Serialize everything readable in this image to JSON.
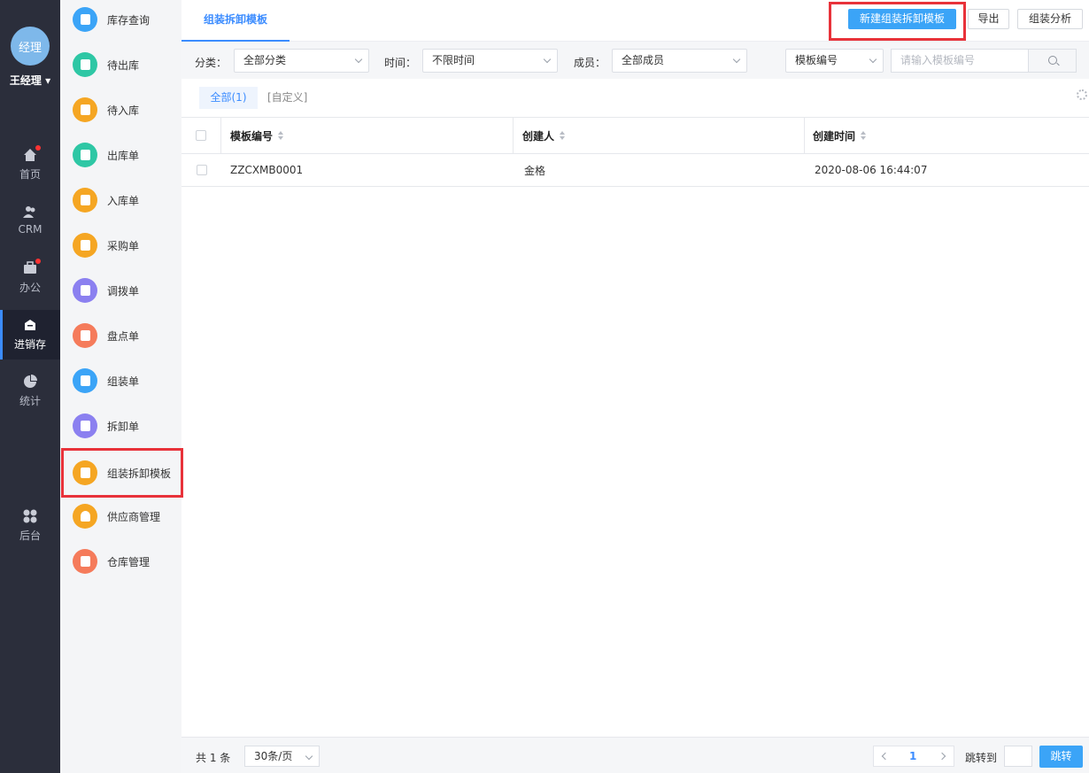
{
  "rail": {
    "avatar": "经理",
    "user_name": "王经理",
    "items": [
      {
        "label": "首页",
        "icon": "home-icon",
        "dot": true
      },
      {
        "label": "CRM",
        "icon": "users-icon",
        "dot": false
      },
      {
        "label": "办公",
        "icon": "briefcase-icon",
        "dot": true
      },
      {
        "label": "进销存",
        "icon": "inventory-icon",
        "dot": false,
        "active": true
      },
      {
        "label": "统计",
        "icon": "pie-chart-icon",
        "dot": false
      },
      {
        "label": "后台",
        "icon": "grid-icon",
        "dot": false
      }
    ]
  },
  "submenu": {
    "items": [
      {
        "label": "库存查询",
        "color": "#3ba4f7"
      },
      {
        "label": "待出库",
        "color": "#2ec7a5"
      },
      {
        "label": "待入库",
        "color": "#f5a623"
      },
      {
        "label": "出库单",
        "color": "#2ec7a5"
      },
      {
        "label": "入库单",
        "color": "#f5a623"
      },
      {
        "label": "采购单",
        "color": "#f5a623"
      },
      {
        "label": "调拨单",
        "color": "#8b80f0"
      },
      {
        "label": "盘点单",
        "color": "#f57b5b"
      },
      {
        "label": "组装单",
        "color": "#3ba4f7"
      },
      {
        "label": "拆卸单",
        "color": "#8b80f0"
      },
      {
        "label": "组装拆卸模板",
        "color": "#f5a623",
        "selected": true
      },
      {
        "label": "供应商管理",
        "color": "#f5a623"
      },
      {
        "label": "仓库管理",
        "color": "#f57b5b"
      }
    ]
  },
  "header": {
    "tab": "组装拆卸模板",
    "new_button": "新建组装拆卸模板",
    "export_button": "导出",
    "analysis_button": "组装分析"
  },
  "filters": {
    "category_label": "分类：",
    "category_value": "全部分类",
    "time_label": "时间：",
    "time_value": "不限时间",
    "member_label": "成员：",
    "member_value": "全部成员",
    "search_field": "模板编号",
    "search_placeholder": "请输入模板编号"
  },
  "views": {
    "all": "全部(1)",
    "custom": "[自定义]"
  },
  "table": {
    "columns": [
      "模板编号",
      "创建人",
      "创建时间"
    ],
    "rows": [
      [
        "ZZCXMB0001",
        "金格",
        "2020-08-06 16:44:07"
      ]
    ]
  },
  "footer": {
    "total": "共 1 条",
    "page_size": "30条/页",
    "current_page": "1",
    "jump_label": "跳转到",
    "jump_button": "跳转"
  },
  "colors": {
    "accent": "#3b8cff",
    "primary_button": "#3ba4f7",
    "highlight": "#e8323a",
    "rail_bg": "#2b2e3b"
  }
}
